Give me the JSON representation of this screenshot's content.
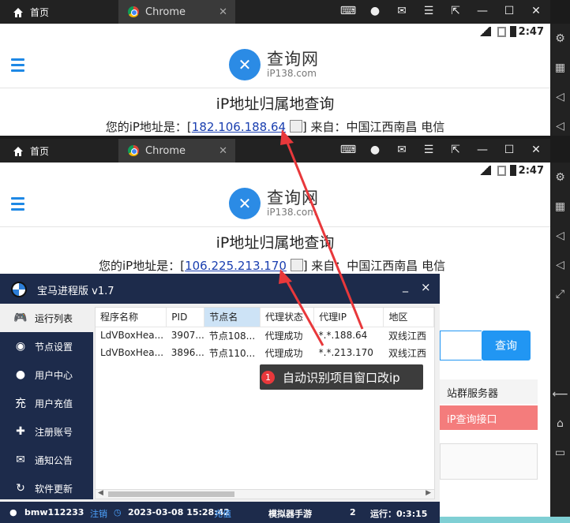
{
  "emulator": {
    "home_label": "首页",
    "tab_label": "Chrome",
    "tab_close": "✕",
    "time": "2:47"
  },
  "site": {
    "logo_cn": "查询网",
    "logo_en": "iP138.com",
    "page_title": "iP地址归属地查询",
    "ip_prefix": "您的iP地址是：[",
    "ip_suffix": "] 来自：中国江西南昌 电信",
    "ip_top": "182.106.188.64",
    "ip_bottom": "106.225.213.170",
    "query_button": "查询",
    "server_label": "站群服务器",
    "ip_api_label": "iP查询接口"
  },
  "app": {
    "title": "宝马进程版  v1.7",
    "min": "_",
    "close": "×",
    "nav": [
      {
        "label": "运行列表",
        "icon": "gamepad-icon"
      },
      {
        "label": "节点设置",
        "icon": "globe-icon"
      },
      {
        "label": "用户中心",
        "icon": "user-icon"
      },
      {
        "label": "用户充值",
        "icon": "recharge-icon"
      },
      {
        "label": "注册账号",
        "icon": "add-user-icon"
      },
      {
        "label": "通知公告",
        "icon": "chat-icon"
      },
      {
        "label": "软件更新",
        "icon": "refresh-icon"
      }
    ],
    "table": {
      "headers": [
        "程序名称",
        "PID",
        "节点名",
        "代理状态",
        "代理IP",
        "地区"
      ],
      "rows": [
        [
          "LdVBoxHea...",
          "3907...",
          "节点108...",
          "代理成功",
          "*.*.188.64",
          "双线江西"
        ],
        [
          "LdVBoxHea...",
          "3896...",
          "节点110...",
          "代理成功",
          "*.*.213.170",
          "双线江西"
        ]
      ]
    },
    "status": {
      "user": "bmw112233",
      "logout": "注销",
      "datetime": "2023-03-08 15:28:42",
      "recharge": "充值",
      "emulator": "模拟器手游",
      "count": "2",
      "runtime": "运行：0:3:15"
    }
  },
  "tooltip": {
    "num": "1",
    "text": "自动识别项目窗口改ip"
  },
  "colors": {
    "accent": "#2196f3",
    "app_bg": "#1d2b4b",
    "arrow": "#e8383b"
  }
}
